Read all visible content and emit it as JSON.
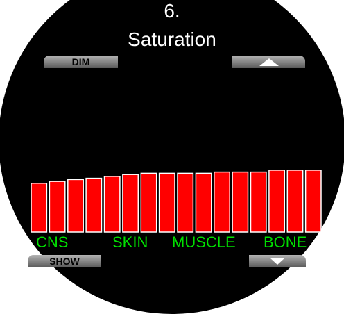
{
  "screen": {
    "number": "6.",
    "title": "Saturation"
  },
  "softkeys": {
    "dim_label": "DIM",
    "show_label": "SHOW",
    "up_icon": "up-arrow-icon",
    "down_icon": "down-arrow-icon"
  },
  "tissue_labels": {
    "cns": "CNS",
    "skin": "SKIN",
    "muscle": "MUSCLE",
    "bone": "BONE"
  },
  "colors": {
    "background": "#000000",
    "bar_fill": "#ff0000",
    "bar_outline": "#ffffff",
    "label_green": "#00e000"
  },
  "chart_data": {
    "type": "bar",
    "compartment_count": 16,
    "values": [
      0.78,
      0.81,
      0.84,
      0.86,
      0.89,
      0.92,
      0.94,
      0.94,
      0.94,
      0.94,
      0.96,
      0.96,
      0.96,
      0.99,
      0.99,
      0.99
    ]
  }
}
